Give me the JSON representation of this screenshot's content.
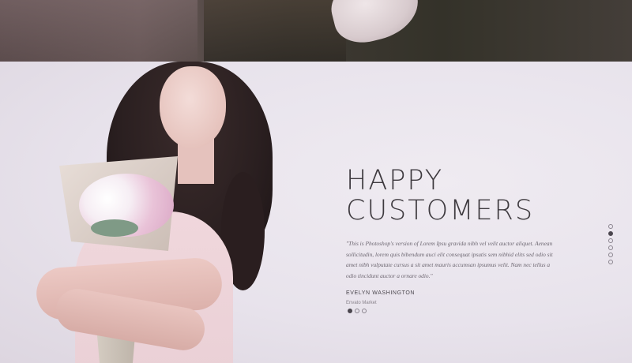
{
  "testimonial": {
    "heading_line1": "HAPPY",
    "heading_line2": "CUSTOMERS",
    "quote": "\"This is Photoshop's version of Lorem Ipsu gravida nibh vel velit auctor aliquet. Aenean sollicitudin, lorem quis bibendum auci elit consequat ipsutis sem nibhid elits sed odio sit amet nibh vulputate cursus a sit amet mauris accumsan ipsumus velit. Nam nec tellus a odio tincidunt auctor a ornare odio.\"",
    "author": "EVELYN WASHINGTON",
    "company": "Envato Market",
    "slides_total": 3,
    "active_slide": 1
  },
  "section_nav": {
    "items_total": 6,
    "active_item": 2
  },
  "colors": {
    "heading": "#3e3a3f",
    "body_text": "#6c6670",
    "background": "#e9e4ec",
    "active_dot": "#4b464e"
  }
}
